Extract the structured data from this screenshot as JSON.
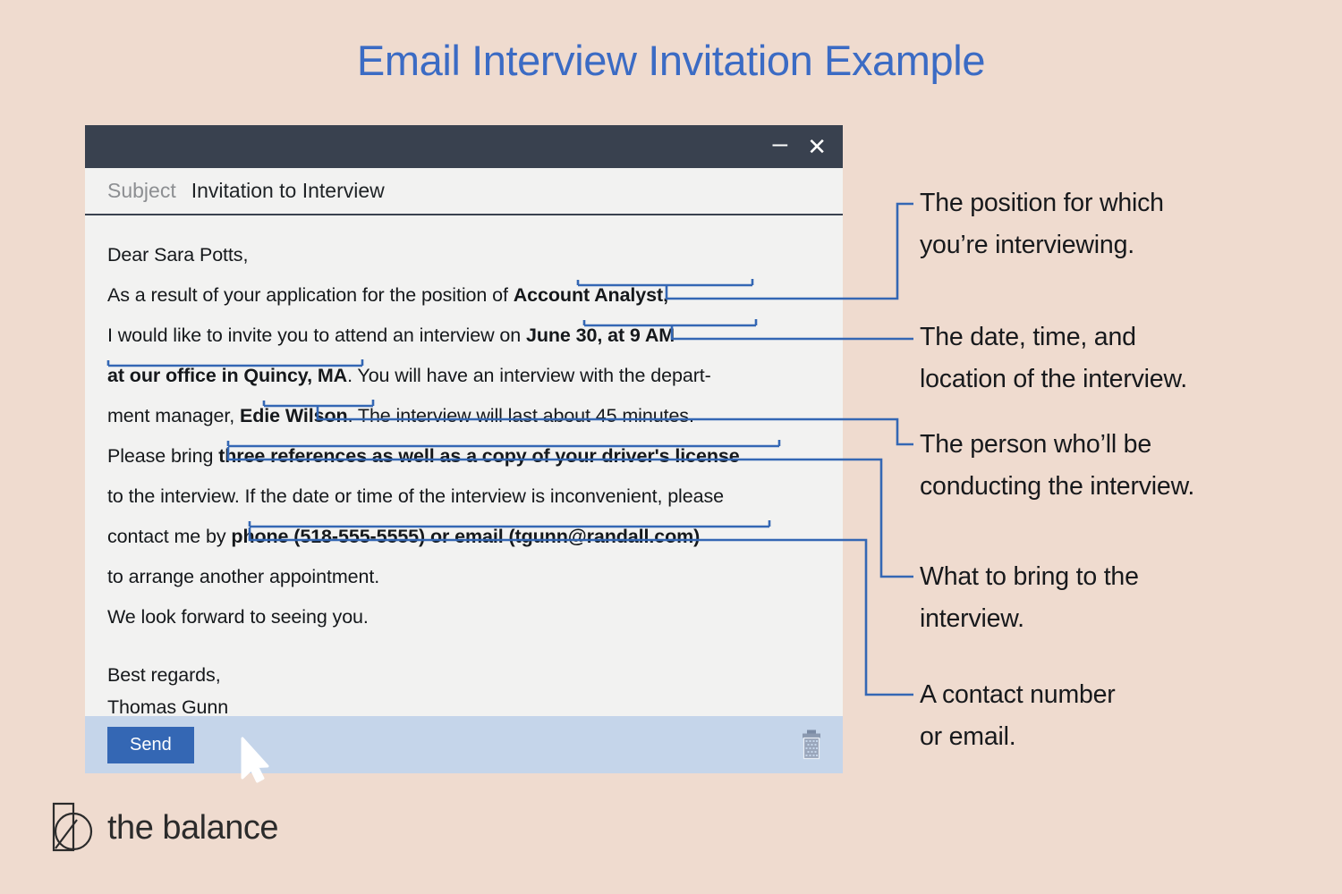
{
  "page": {
    "title": "Email Interview Invitation Example",
    "background_color": "#efdbcf",
    "title_color": "#3b6bc4",
    "annotation_color": "#3467b4"
  },
  "email_window": {
    "title_bar": {
      "minimize_label": "–",
      "close_label": "✕",
      "background_color": "#39414f"
    },
    "subject": {
      "label": "Subject",
      "value": "Invitation to Interview"
    },
    "body": {
      "lines": [
        {
          "id": "greeting",
          "segments": [
            {
              "text": "Dear Sara Potts,",
              "bold": false
            }
          ]
        },
        {
          "id": "application",
          "segments": [
            {
              "text": "As a result of your application for the position of ",
              "bold": false
            },
            {
              "text": "Account Analyst,",
              "bold": true
            }
          ]
        },
        {
          "id": "invite",
          "segments": [
            {
              "text": "I  would like to invite you to attend an interview on ",
              "bold": false
            },
            {
              "text": "June 30, at 9 AM",
              "bold": true
            }
          ]
        },
        {
          "id": "location",
          "segments": [
            {
              "text": "at our office in Quincy, MA",
              "bold": true
            },
            {
              "text": ". You will have an interview with the depart-",
              "bold": false
            }
          ]
        },
        {
          "id": "manager",
          "segments": [
            {
              "text": "ment manager, ",
              "bold": false
            },
            {
              "text": "Edie Wilson",
              "bold": true
            },
            {
              "text": ". The interview will last about 45 minutes.",
              "bold": false
            }
          ]
        },
        {
          "id": "bring",
          "segments": [
            {
              "text": "Please bring ",
              "bold": false
            },
            {
              "text": "three references as well as a copy of your driver's license",
              "bold": true
            }
          ]
        },
        {
          "id": "reschedule",
          "segments": [
            {
              "text": "to the interview. If the date or time of the interview is inconvenient, please",
              "bold": false
            }
          ]
        },
        {
          "id": "contact",
          "segments": [
            {
              "text": "contact me by ",
              "bold": false
            },
            {
              "text": "phone (518-555-5555) or email (tgunn@randall.com)",
              "bold": true
            }
          ]
        },
        {
          "id": "arrange",
          "segments": [
            {
              "text": "to arrange another appointment.",
              "bold": false
            }
          ]
        },
        {
          "id": "forward",
          "segments": [
            {
              "text": "We look forward to seeing you.",
              "bold": false
            }
          ]
        }
      ],
      "signoff": "Best regards,",
      "sender": "Thomas Gunn"
    },
    "footer": {
      "send_label": "Send",
      "background_color": "#c5d5ea",
      "send_color": "#3467b4",
      "trash_icon": "trash-icon"
    }
  },
  "callouts": [
    {
      "id": "position",
      "lines": [
        "The position for which",
        "you’re interviewing."
      ]
    },
    {
      "id": "datetime",
      "lines": [
        "The date, time, and",
        "location of the interview."
      ]
    },
    {
      "id": "interviewer",
      "lines": [
        "The person who’ll be",
        "conducting the interview."
      ]
    },
    {
      "id": "bring",
      "lines": [
        "What to bring to the",
        "interview."
      ]
    },
    {
      "id": "contact",
      "lines": [
        "A contact number",
        "or email."
      ]
    }
  ],
  "logo": {
    "text": "the balance",
    "mark": "balance-logo-mark"
  }
}
